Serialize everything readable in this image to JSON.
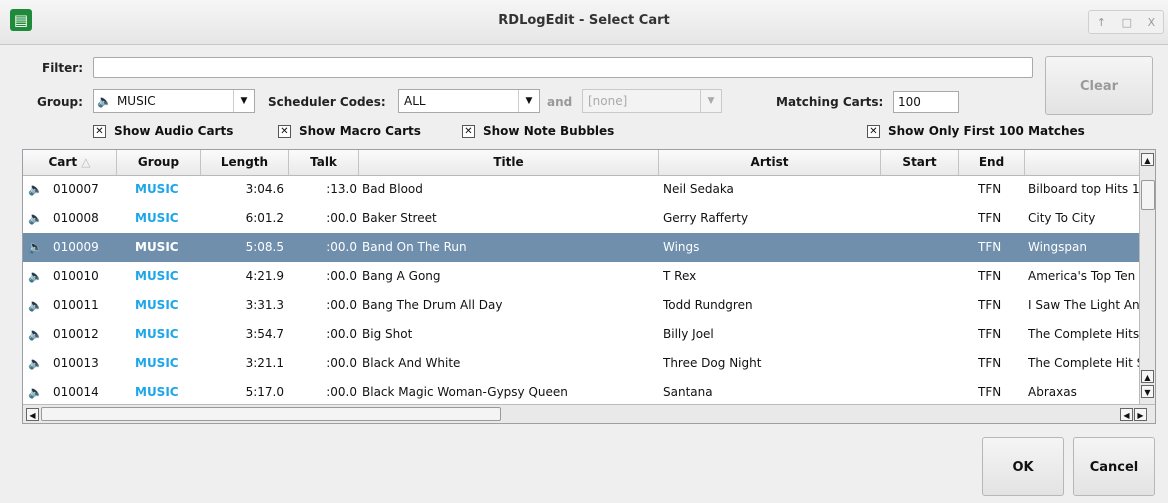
{
  "window": {
    "title": "RDLogEdit - Select Cart",
    "app_icon": "rdlogedit-icon",
    "controls": [
      "↑",
      "□",
      "X"
    ]
  },
  "filter": {
    "label": "Filter:",
    "value": ""
  },
  "clear_label": "Clear",
  "group": {
    "label": "Group:",
    "value": "MUSIC"
  },
  "scheduler": {
    "label": "Scheduler Codes:",
    "value": "ALL",
    "and_label": "and",
    "second_value": "[none]"
  },
  "matching": {
    "label": "Matching Carts:",
    "value": "100"
  },
  "checks": {
    "audio": "Show Audio Carts",
    "macro": "Show Macro Carts",
    "notes": "Show Note Bubbles",
    "first100": "Show Only First 100 Matches"
  },
  "table": {
    "headers": [
      "Cart",
      "Group",
      "Length",
      "Talk",
      "Title",
      "Artist",
      "Start",
      "End",
      ""
    ],
    "rows": [
      {
        "cart": "010007",
        "group": "MUSIC",
        "length": "3:04.6",
        "talk": ":13.0",
        "title": "Bad Blood",
        "artist": "Neil Sedaka",
        "start": "",
        "end": "TFN",
        "album": "Bilboard top Hits 1"
      },
      {
        "cart": "010008",
        "group": "MUSIC",
        "length": "6:01.2",
        "talk": ":00.0",
        "title": "Baker Street",
        "artist": "Gerry Rafferty",
        "start": "",
        "end": "TFN",
        "album": "City To City"
      },
      {
        "cart": "010009",
        "group": "MUSIC",
        "length": "5:08.5",
        "talk": ":00.0",
        "title": "Band On The Run",
        "artist": "Wings",
        "start": "",
        "end": "TFN",
        "album": "Wingspan"
      },
      {
        "cart": "010010",
        "group": "MUSIC",
        "length": "4:21.9",
        "talk": ":00.0",
        "title": "Bang A Gong",
        "artist": "T Rex",
        "start": "",
        "end": "TFN",
        "album": "America's Top Ten"
      },
      {
        "cart": "010011",
        "group": "MUSIC",
        "length": "3:31.3",
        "talk": ":00.0",
        "title": "Bang The Drum All Day",
        "artist": "Todd Rundgren",
        "start": "",
        "end": "TFN",
        "album": "I Saw The Light An"
      },
      {
        "cart": "010012",
        "group": "MUSIC",
        "length": "3:54.7",
        "talk": ":00.0",
        "title": "Big Shot",
        "artist": "Billy Joel",
        "start": "",
        "end": "TFN",
        "album": "The Complete Hits"
      },
      {
        "cart": "010013",
        "group": "MUSIC",
        "length": "3:21.1",
        "talk": ":00.0",
        "title": "Black And White",
        "artist": "Three Dog Night",
        "start": "",
        "end": "TFN",
        "album": "The Complete Hit S"
      },
      {
        "cart": "010014",
        "group": "MUSIC",
        "length": "5:17.0",
        "talk": ":00.0",
        "title": "Black Magic Woman-Gypsy Queen",
        "artist": "Santana",
        "start": "",
        "end": "TFN",
        "album": "Abraxas"
      }
    ]
  },
  "ok_label": "OK",
  "cancel_label": "Cancel",
  "colors": {
    "selection": "#6f8fad",
    "group_text": "#1da6ea"
  }
}
